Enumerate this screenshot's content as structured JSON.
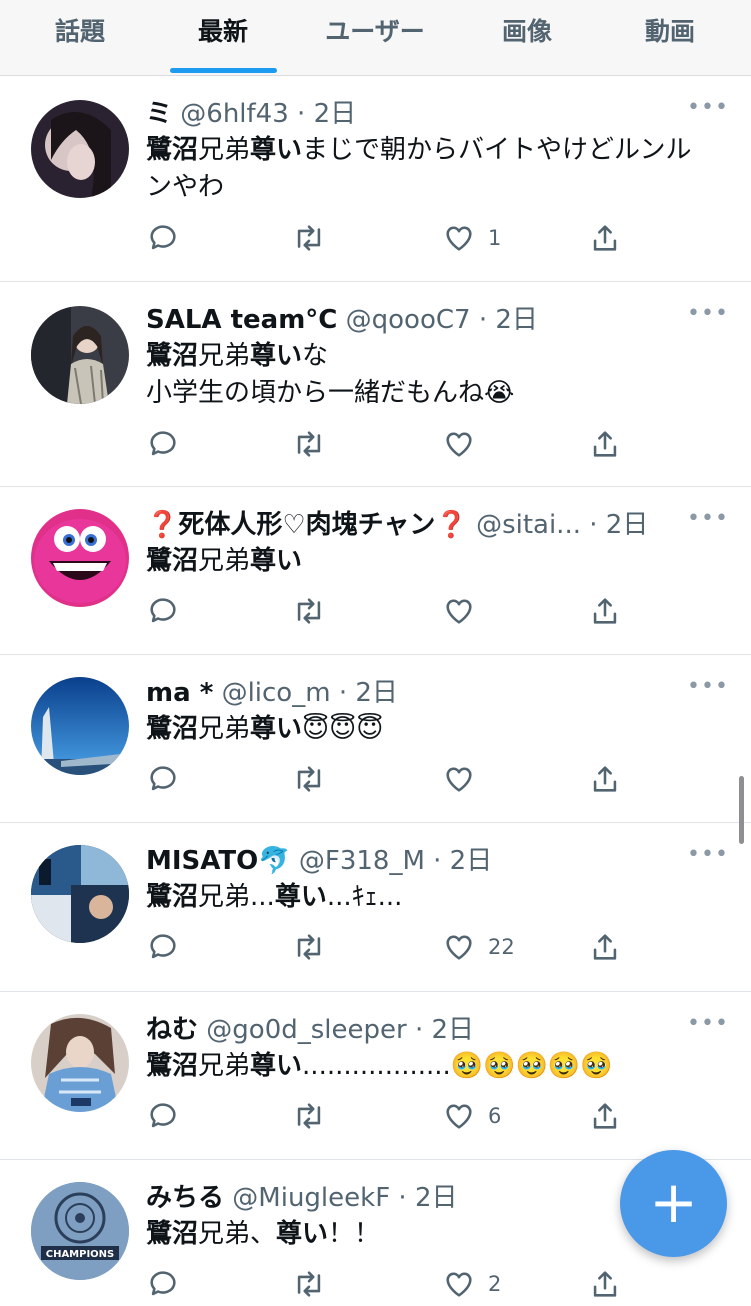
{
  "tabs": [
    {
      "label": "話題",
      "active": false
    },
    {
      "label": "最新",
      "active": true
    },
    {
      "label": "ユーザー",
      "active": false
    },
    {
      "label": "画像",
      "active": false
    },
    {
      "label": "動画",
      "active": false
    }
  ],
  "accent_color": "#1d9bf0",
  "tweets": [
    {
      "name": "ミ",
      "handle": "@6hlf43",
      "separator": "·",
      "time": "2日",
      "text_line1_a": "鷺沼",
      "text_line1_b": "兄弟",
      "text_line1_c": "尊い",
      "text_line1_d": "まじで朝からバイトやけどルンル",
      "text_line2": "ンやわ",
      "like_count": "1"
    },
    {
      "name": "SALA team°C",
      "handle": "@qoooC7",
      "separator": "·",
      "time": "2日",
      "text_line1_a": "鷺沼",
      "text_line1_b": "兄弟",
      "text_line1_c": "尊い",
      "text_line1_d": "な",
      "text_line2": "小学生の頃から一緒だもんね😭",
      "like_count": ""
    },
    {
      "name": "❓死体人形♡肉塊チャン❓",
      "handle": "@sitai...",
      "separator": "·",
      "time": "2日",
      "text_line1_a": "鷺沼",
      "text_line1_b": "兄弟",
      "text_line1_c": "尊い",
      "text_line1_d": "",
      "like_count": ""
    },
    {
      "name": "ma *",
      "handle": "@lico_m",
      "separator": "·",
      "time": "2日",
      "text_line1_a": "鷺沼",
      "text_line1_b": "兄弟",
      "text_line1_c": "尊い",
      "text_line1_d": "😇😇😇",
      "like_count": ""
    },
    {
      "name": "MISATO🐬",
      "handle": "@F318_M",
      "separator": "·",
      "time": "2日",
      "text_line1_a": "鷺沼",
      "text_line1_b": "兄弟...",
      "text_line1_c": "尊い",
      "text_line1_d": "...ｷｪ...",
      "like_count": "22"
    },
    {
      "name": "ねむ",
      "handle": "@go0d_sleeper",
      "separator": "·",
      "time": "2日",
      "text_line1_a": "鷺沼",
      "text_line1_b": "兄弟",
      "text_line1_c": "尊い",
      "text_line1_d": "..................🥹🥹🥹🥹🥹",
      "like_count": "6"
    },
    {
      "name": "みちる",
      "handle": "@MiugleekF",
      "separator": "·",
      "time": "2日",
      "text_line1_a": "鷺沼",
      "text_line1_b": "兄弟、",
      "text_line1_c": "尊い",
      "text_line1_d": "！！",
      "like_count": "2"
    }
  ],
  "more_label": "•••",
  "fab_label": "+"
}
